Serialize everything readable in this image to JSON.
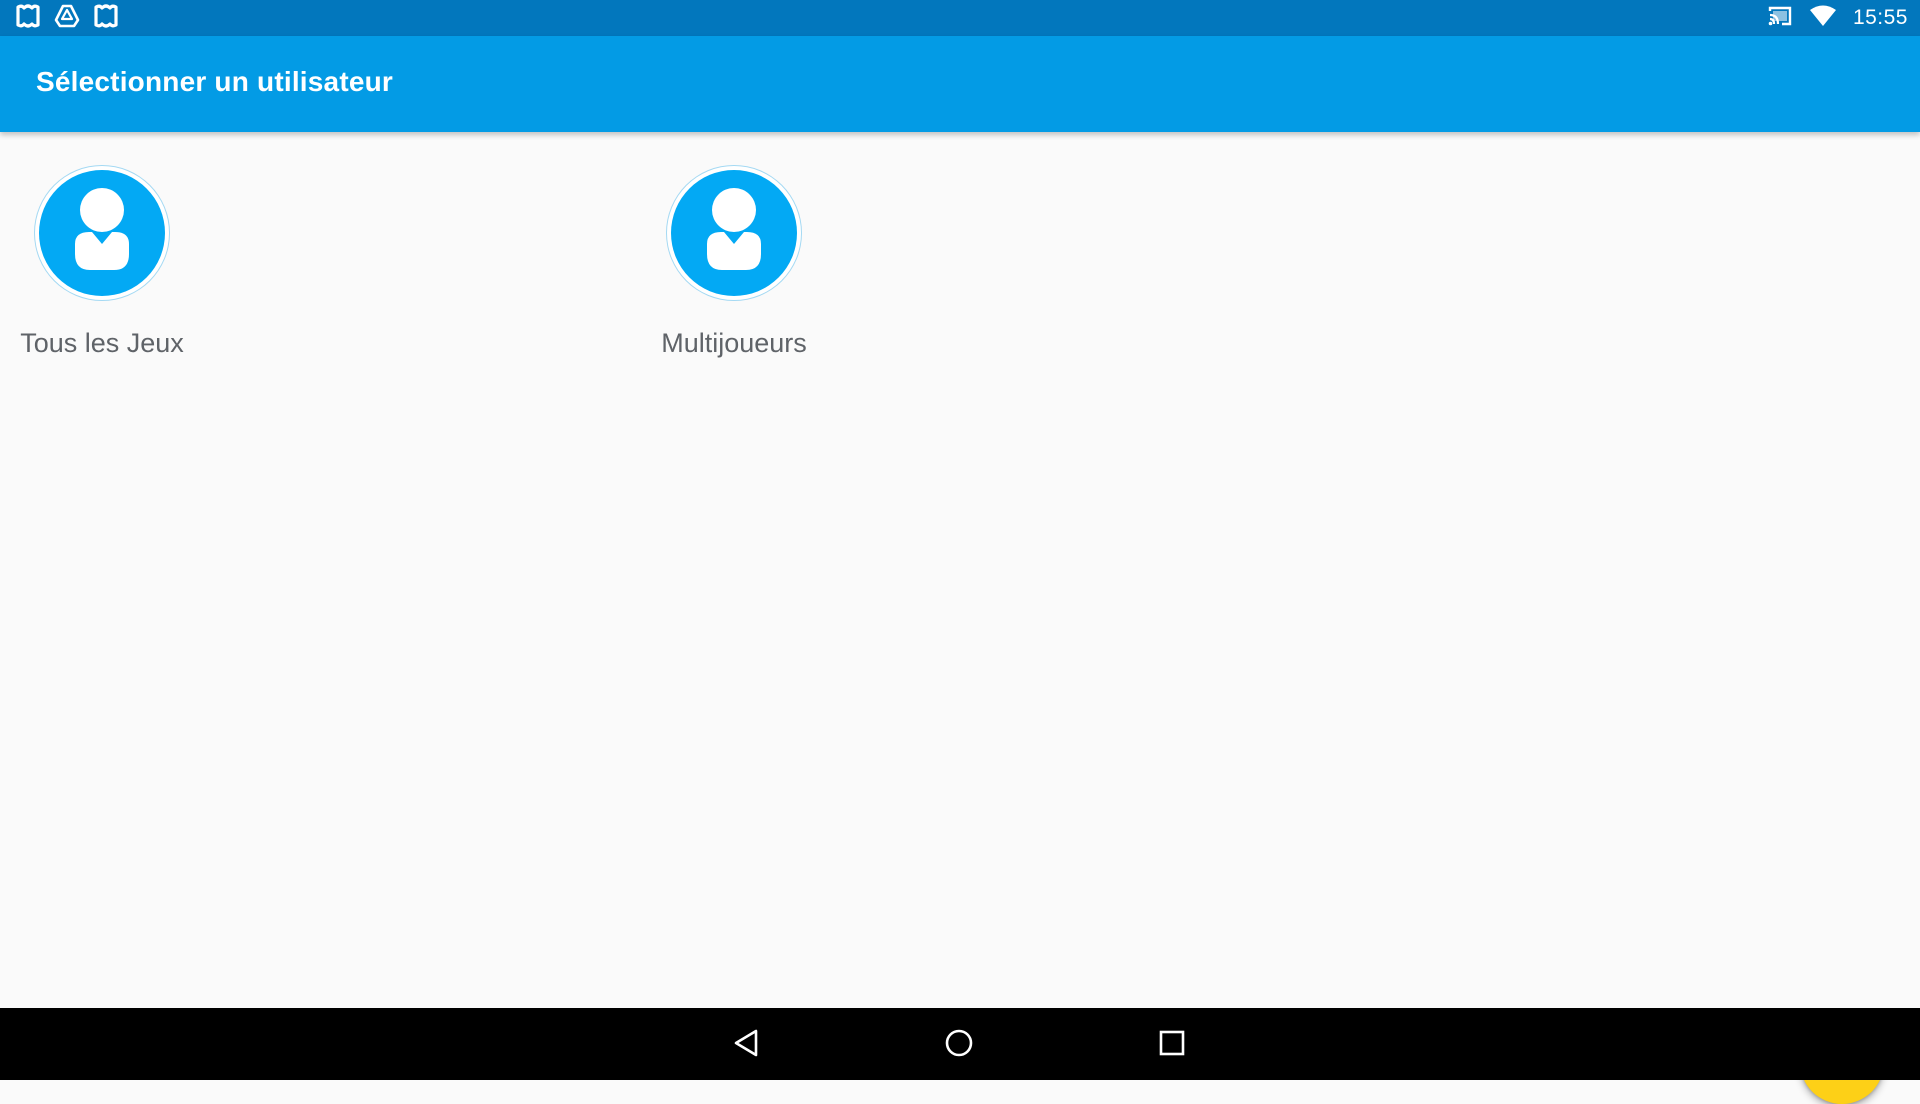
{
  "status_bar": {
    "left_icons": [
      "notification-app-icon",
      "drive-icon",
      "notification-app-icon"
    ],
    "right_icons": [
      "cast-icon",
      "wifi-icon"
    ],
    "time": "15:55"
  },
  "app_bar": {
    "title": "Sélectionner un utilisateur",
    "color": "#039be5"
  },
  "users": [
    {
      "name": "Tous les Jeux",
      "icon": "user-avatar-icon"
    },
    {
      "name": "Multijoueurs",
      "icon": "user-avatar-icon"
    }
  ],
  "fab": {
    "icon": "plus-icon",
    "color": "#fdd017"
  },
  "nav_bar": {
    "buttons": [
      "back-icon",
      "home-icon",
      "recents-icon"
    ]
  },
  "colors": {
    "status_bar": "#0277bd",
    "avatar": "#03a9f4",
    "background": "#fafafa"
  }
}
